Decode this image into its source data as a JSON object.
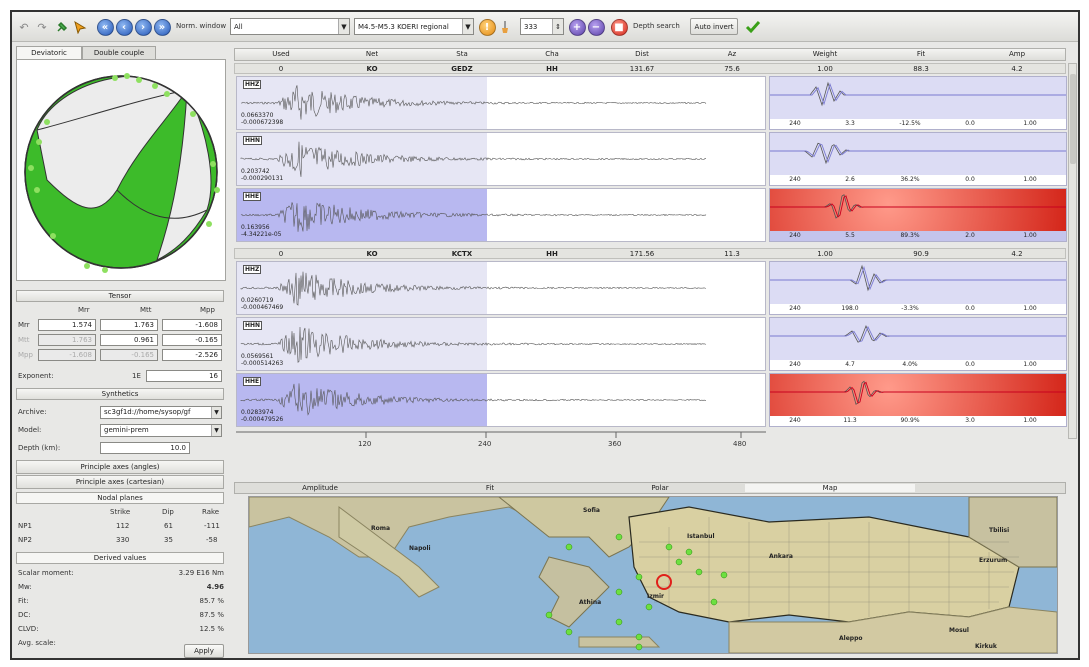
{
  "toolbar": {
    "norm_window_label": "Norm. window",
    "norm_window_value": "All",
    "event_value": "M4.5-M5.3 KOERI regional",
    "spin_value": "333",
    "depth_search_label": "Depth search",
    "auto_invert_label": "Auto invert"
  },
  "left": {
    "tabs": [
      "Deviatoric",
      "Double couple"
    ],
    "tensor_label": "Tensor",
    "tensor_cols": [
      "Mrr",
      "Mtt",
      "Mpp"
    ],
    "tensor_rows": [
      {
        "label": "Mrr",
        "values": [
          "1.574",
          "1.763",
          "-1.608"
        ]
      },
      {
        "label": "Mtt",
        "values": [
          "1.763",
          "0.961",
          "-0.165"
        ]
      },
      {
        "label": "Mpp",
        "values": [
          "-1.608",
          "-0.165",
          "-2.526"
        ]
      }
    ],
    "exponent_label": "Exponent:",
    "exponent_prefix": "1E",
    "exponent_value": "16",
    "synthetics_label": "Synthetics",
    "archive_label": "Archive:",
    "archive_value": "sc3gf1d://home/sysop/gf",
    "model_label": "Model:",
    "model_value": "gemini-prem",
    "depth_label": "Depth (km):",
    "depth_value": "10.0",
    "principle_angles": "Principle axes (angles)",
    "principle_cart": "Principle axes (cartesian)",
    "nodal_label": "Nodal planes",
    "nodal_cols": [
      "Strike",
      "Dip",
      "Rake"
    ],
    "nodal_rows": [
      {
        "label": "NP1",
        "values": [
          "112",
          "61",
          "-111"
        ]
      },
      {
        "label": "NP2",
        "values": [
          "330",
          "35",
          "-58"
        ]
      }
    ],
    "derived_label": "Derived values",
    "derived": [
      {
        "label": "Scalar moment:",
        "value": "3.29 E16 Nm"
      },
      {
        "label": "Mw:",
        "value": "4.96"
      },
      {
        "label": "Fit:",
        "value": "85.7 %"
      },
      {
        "label": "DC:",
        "value": "87.5 %"
      },
      {
        "label": "CLVD:",
        "value": "12.5 %"
      },
      {
        "label": "Avg. scale:",
        "value": ""
      }
    ],
    "apply_label": "Apply"
  },
  "table": {
    "headers": [
      "Used",
      "Net",
      "Sta",
      "Cha",
      "Dist",
      "Az",
      "Weight",
      "Fit",
      "Amp"
    ],
    "stations": [
      {
        "summary": [
          "0",
          "KO",
          "GEDZ",
          "HH",
          "131.67",
          "75.6",
          "1.00",
          "88.3",
          "4.2"
        ],
        "traces": [
          {
            "comp": "HHZ",
            "amp1": "0.0663370",
            "amp2": "-0.000672398",
            "fit": [
              "240",
              "3.3",
              "-12.5%",
              "0.0",
              "1.00"
            ]
          },
          {
            "comp": "HHN",
            "amp1": "0.203742",
            "amp2": "-0.000290131",
            "fit": [
              "240",
              "2.6",
              "36.2%",
              "0.0",
              "1.00"
            ]
          },
          {
            "comp": "HHE",
            "amp1": "0.163956",
            "amp2": "-4.34221e-05",
            "fit": [
              "240",
              "5.5",
              "89.3%",
              "2.0",
              "1.00"
            ]
          }
        ]
      },
      {
        "summary": [
          "0",
          "KO",
          "KCTX",
          "HH",
          "171.56",
          "11.3",
          "1.00",
          "90.9",
          "4.2"
        ],
        "traces": [
          {
            "comp": "HHZ",
            "amp1": "0.0260719",
            "amp2": "-0.000467469",
            "fit": [
              "240",
              "198.0",
              "-3.3%",
              "0.0",
              "1.00"
            ]
          },
          {
            "comp": "HHN",
            "amp1": "0.0569561",
            "amp2": "-0.000514263",
            "fit": [
              "240",
              "4.7",
              "4.0%",
              "0.0",
              "1.00"
            ]
          },
          {
            "comp": "HHE",
            "amp1": "0.0283974",
            "amp2": "-0.000479526",
            "fit": [
              "240",
              "11.3",
              "90.9%",
              "3.0",
              "1.00"
            ]
          }
        ]
      }
    ],
    "axis_ticks": [
      "120",
      "240",
      "360",
      "480"
    ]
  },
  "maptabs": [
    "Amplitude",
    "Fit",
    "Polar",
    "Map"
  ],
  "map": {
    "places": [
      "Roma",
      "Napoli",
      "Sofia",
      "Athina",
      "Ankara",
      "Erzurum",
      "Aleppo",
      "Mosul",
      "Tbilisi",
      "Kirkuk",
      "Izmir",
      "Istanbul"
    ]
  },
  "colors": {
    "beachball_fill": "#3dbb2a",
    "trace_bg_selected": "#b8b8f0",
    "fit_red": "#c8001e"
  }
}
